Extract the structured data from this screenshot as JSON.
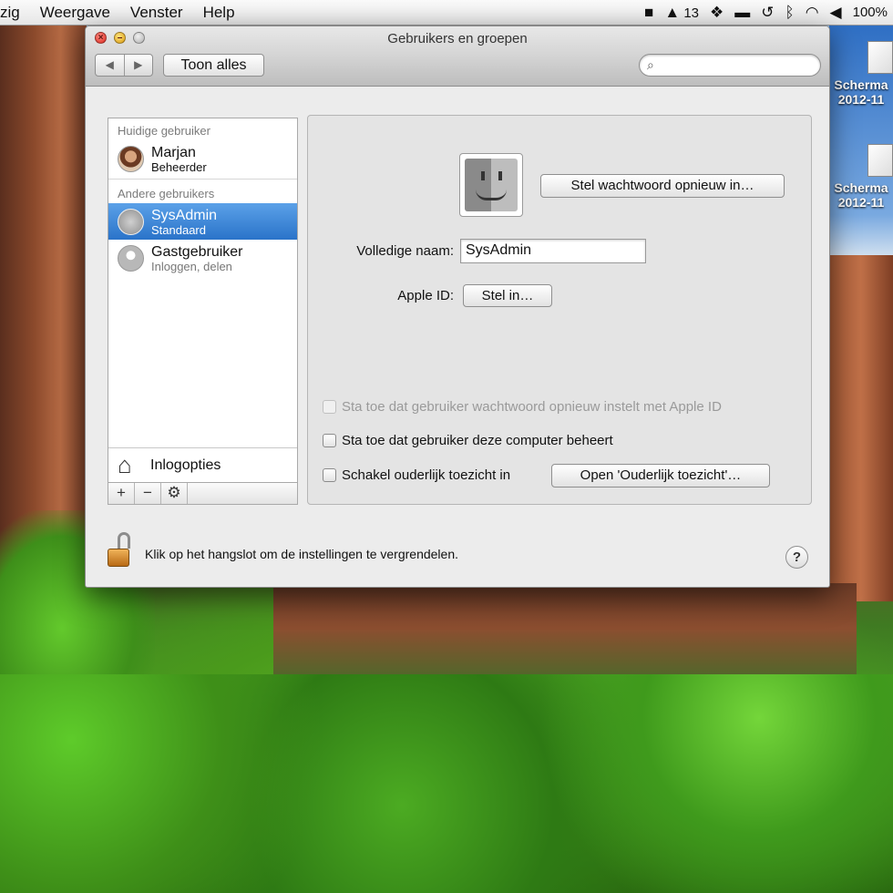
{
  "menubar": {
    "items": [
      "zig",
      "Weergave",
      "Venster",
      "Help"
    ],
    "status": {
      "notification_count": "13",
      "battery": "100%"
    }
  },
  "desktop": {
    "icons": [
      {
        "line1": "Scherma",
        "line2": "2012-11"
      },
      {
        "line1": "Scherma",
        "line2": "2012-11"
      }
    ]
  },
  "window": {
    "title": "Gebruikers en groepen",
    "toolbar": {
      "back_label": "◀",
      "forward_label": "▶",
      "show_all_label": "Toon alles",
      "search_value": ""
    }
  },
  "sidebar": {
    "current_user_header": "Huidige gebruiker",
    "other_users_header": "Andere gebruikers",
    "current_user": {
      "name": "Marjan",
      "role": "Beheerder"
    },
    "other_users": [
      {
        "name": "SysAdmin",
        "role": "Standaard",
        "selected": true
      },
      {
        "name": "Gastgebruiker",
        "role": "Inloggen, delen",
        "selected": false
      }
    ],
    "login_options_label": "Inlogopties",
    "tools": {
      "add": "+",
      "remove": "−",
      "gear": "⚙"
    }
  },
  "details": {
    "reset_password_label": "Stel wachtwoord opnieuw in…",
    "full_name_label": "Volledige naam:",
    "full_name_value": "SysAdmin",
    "apple_id_label": "Apple ID:",
    "apple_id_button": "Stel in…",
    "checkboxes": [
      {
        "label": "Sta toe dat gebruiker wachtwoord opnieuw instelt met Apple ID",
        "checked": false,
        "enabled": false
      },
      {
        "label": "Sta toe dat gebruiker deze computer beheert",
        "checked": false,
        "enabled": true
      },
      {
        "label": "Schakel ouderlijk toezicht in",
        "checked": false,
        "enabled": true
      }
    ],
    "parental_button": "Open 'Ouderlijk toezicht'…"
  },
  "footer": {
    "lock_text": "Klik op het hangslot om de instellingen te vergrendelen.",
    "help_label": "?"
  }
}
